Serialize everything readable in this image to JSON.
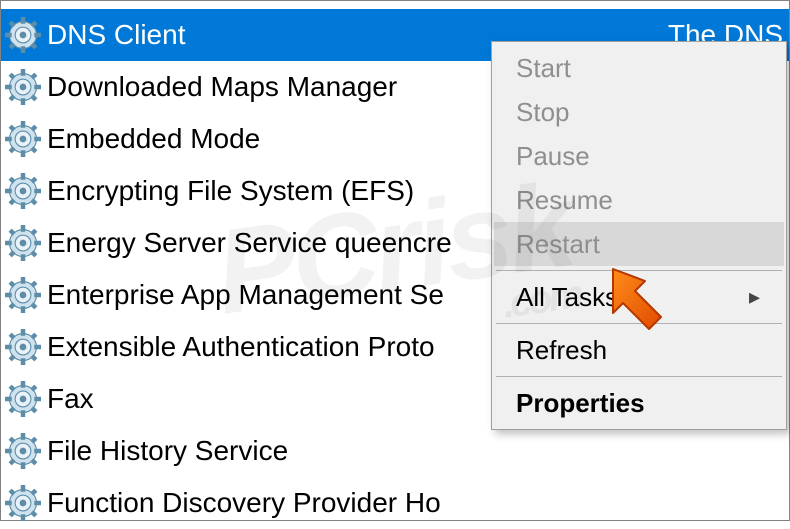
{
  "services": [
    {
      "name": "DNS Client",
      "selected": true
    },
    {
      "name": "Downloaded Maps Manager",
      "selected": false
    },
    {
      "name": "Embedded Mode",
      "selected": false
    },
    {
      "name": "Encrypting File System (EFS)",
      "selected": false
    },
    {
      "name": "Energy Server Service queencre",
      "selected": false
    },
    {
      "name": "Enterprise App Management Se",
      "selected": false
    },
    {
      "name": "Extensible Authentication Proto",
      "selected": false
    },
    {
      "name": "Fax",
      "selected": false
    },
    {
      "name": "File History Service",
      "selected": false
    },
    {
      "name": "Function Discovery Provider Ho",
      "selected": false
    }
  ],
  "description_fragment": "The DNS",
  "menu": {
    "start": "Start",
    "stop": "Stop",
    "pause": "Pause",
    "resume": "Resume",
    "restart": "Restart",
    "alltasks": "All Tasks",
    "refresh": "Refresh",
    "properties": "Properties"
  },
  "watermark": {
    "main": "PCrisk",
    "sub": ".com"
  }
}
